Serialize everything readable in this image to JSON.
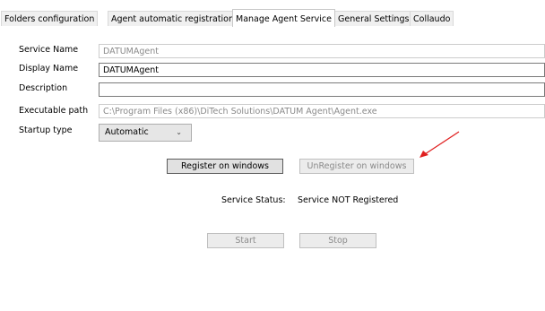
{
  "tabs": [
    {
      "label": "Folders configuration",
      "active": false
    },
    {
      "label": "Agent automatic registration",
      "active": false
    },
    {
      "label": "Manage Agent Service",
      "active": true
    },
    {
      "label": "General Settings",
      "active": false
    },
    {
      "label": "Collaudo",
      "active": false
    }
  ],
  "form": {
    "service_name": {
      "label": "Service Name",
      "value": "DATUMAgent"
    },
    "display_name": {
      "label": "Display Name",
      "value": "DATUMAgent"
    },
    "description": {
      "label": "Description",
      "value": ""
    },
    "executable_path": {
      "label": "Executable path",
      "value": "C:\\Program Files (x86)\\DiTech Solutions\\DATUM Agent\\Agent.exe"
    },
    "startup_type": {
      "label": "Startup type",
      "value": "Automatic",
      "chevron": "chevron-down-icon"
    }
  },
  "buttons": {
    "register": "Register on windows",
    "unregister": "UnRegister on windows",
    "start": "Start",
    "stop": "Stop"
  },
  "service_status": {
    "label": "Service Status:",
    "value": "Service NOT Registered"
  },
  "annotation": {
    "arrow_color": "#e02020"
  }
}
